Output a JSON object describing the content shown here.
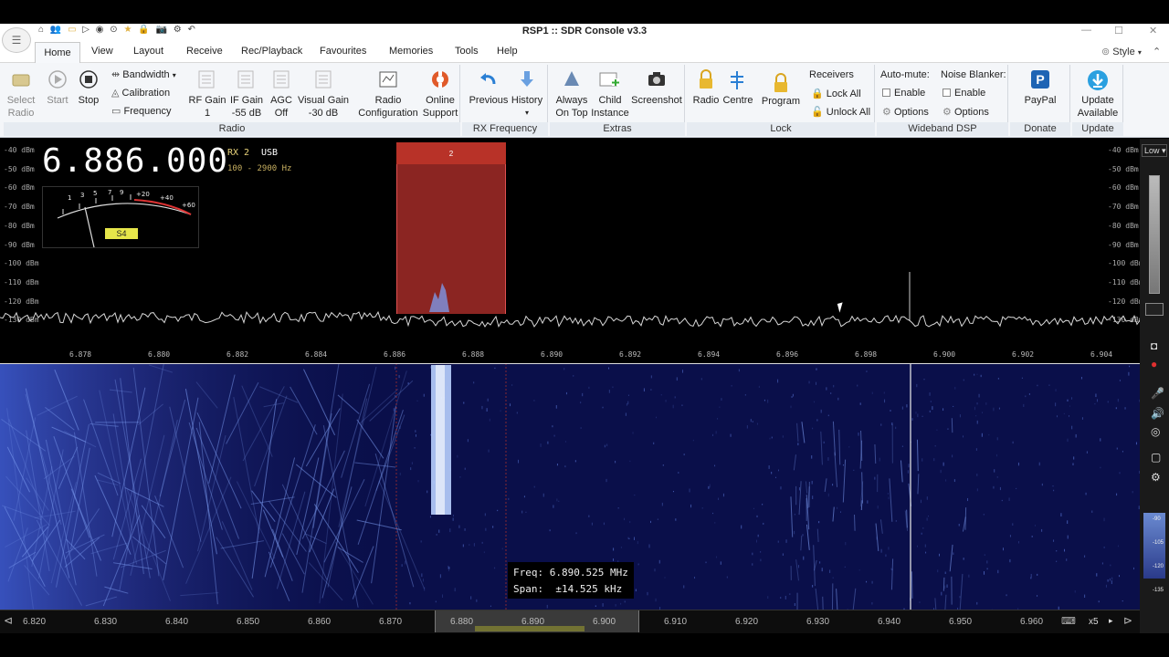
{
  "window": {
    "title": "RSP1 :: SDR Console v3.3",
    "app_button": "☰",
    "style_label": "Style"
  },
  "menu": {
    "home": "Home",
    "items": [
      "View",
      "Layout",
      "Receive",
      "Rec/Playback",
      "Favourites",
      "Memories",
      "Tools",
      "Help"
    ]
  },
  "ribbon": {
    "radio": {
      "select_radio": [
        "Select",
        "Radio"
      ],
      "start": "Start",
      "stop": "Stop",
      "bandwidth": "Bandwidth",
      "calibration": "Calibration",
      "frequency": "Frequency",
      "rf_gain": [
        "RF Gain",
        "1"
      ],
      "if_gain": [
        "IF Gain",
        "-55 dB"
      ],
      "agc": [
        "AGC",
        "Off"
      ],
      "visual_gain": [
        "Visual Gain",
        "-30 dB"
      ],
      "radio_configuration": [
        "Radio",
        "Configuration"
      ],
      "online_support": [
        "Online",
        "Support"
      ],
      "group_label": "Radio"
    },
    "rx_frequency": {
      "previous": "Previous",
      "history": "History",
      "group_label": "RX Frequency"
    },
    "extras": {
      "always_on_top": [
        "Always",
        "On Top"
      ],
      "child_instance": [
        "Child",
        "Instance"
      ],
      "screenshot": "Screenshot",
      "group_label": "Extras"
    },
    "lock": {
      "radio": "Radio",
      "centre": "Centre",
      "program": "Program",
      "receivers": "Receivers",
      "lock_all": "Lock All",
      "unlock_all": "Unlock All",
      "group_label": "Lock"
    },
    "wideband_dsp": {
      "auto_mute": "Auto-mute:",
      "noise_blanker": "Noise Blanker:",
      "enable": "Enable",
      "options": "Options",
      "group_label": "Wideband DSP"
    },
    "donate": {
      "paypal": "PayPal",
      "group_label": "Donate"
    },
    "update": {
      "update_available": [
        "Update",
        "Available"
      ],
      "group_label": "Update"
    }
  },
  "spectrum": {
    "frequency_display": "6.886.000",
    "rx_label": "RX 2",
    "mode": "USB",
    "filter_range": "100 - 2900 Hz",
    "s_meter": {
      "reading": "S4",
      "scale_labels": [
        "1",
        "3",
        "5",
        "7",
        "9",
        "+20",
        "+40",
        "+60"
      ]
    },
    "receiver_marker": "2",
    "db_labels": [
      "-40 dBm",
      "-50 dBm",
      "-60 dBm",
      "-70 dBm",
      "-80 dBm",
      "-90 dBm",
      "-100 dBm",
      "-110 dBm",
      "-120 dBm",
      "-130 dBm"
    ],
    "freq_ticks": [
      "6.878",
      "6.880",
      "6.882",
      "6.884",
      "6.886",
      "6.888",
      "6.890",
      "6.892",
      "6.894",
      "6.896",
      "6.898",
      "6.900",
      "6.902",
      "6.904"
    ]
  },
  "waterfall": {
    "info_freq_label": "Freq:",
    "info_freq_value": "6.890.525 MHz",
    "info_span_label": "Span:",
    "info_span_value": "±14.525 kHz"
  },
  "bottom": {
    "freq_ticks": [
      "6.820",
      "6.830",
      "6.840",
      "6.850",
      "6.860",
      "6.870",
      "6.880",
      "6.890",
      "6.900",
      "6.910",
      "6.920",
      "6.930",
      "6.940",
      "6.950",
      "6.960"
    ],
    "zoom": "x5"
  },
  "sidebar": {
    "low_label": "Low",
    "meter_labels": [
      "-90",
      "-105",
      "-120",
      "-135"
    ]
  },
  "colors": {
    "ribbon_bg": "#f4f6f9",
    "rx_band": "#b83228",
    "waterfall_bg": "#0a0f4a",
    "s_meter_badge": "#e6e64a",
    "link_blue": "#2a7fd4"
  }
}
